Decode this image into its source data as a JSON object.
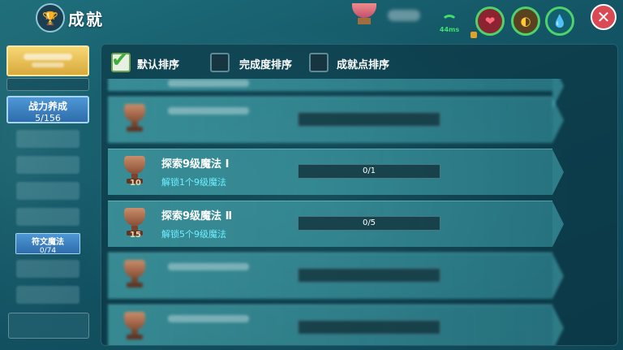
{
  "header": {
    "title": "成就",
    "ping": "44ms"
  },
  "sidebar": {
    "battle_tab": {
      "label": "战力养成",
      "count": "5/156"
    },
    "rune_tab": {
      "label": "符文魔法",
      "count": "0/74"
    }
  },
  "filters": [
    {
      "label": "默认排序",
      "checked": true
    },
    {
      "label": "完成度排序",
      "checked": false
    },
    {
      "label": "成就点排序",
      "checked": false
    }
  ],
  "achievements": [
    {
      "name": "探索9级魔法 Ⅰ",
      "desc": "解锁1个9级魔法",
      "progress": "0/1",
      "points": "10"
    },
    {
      "name": "探索9级魔法 Ⅱ",
      "desc": "解锁5个9级魔法",
      "progress": "0/5",
      "points": "15"
    }
  ],
  "colors": {
    "accent_green": "#3ce06a",
    "desc_cyan": "#6ff0ff",
    "close_red": "#d94a55"
  }
}
